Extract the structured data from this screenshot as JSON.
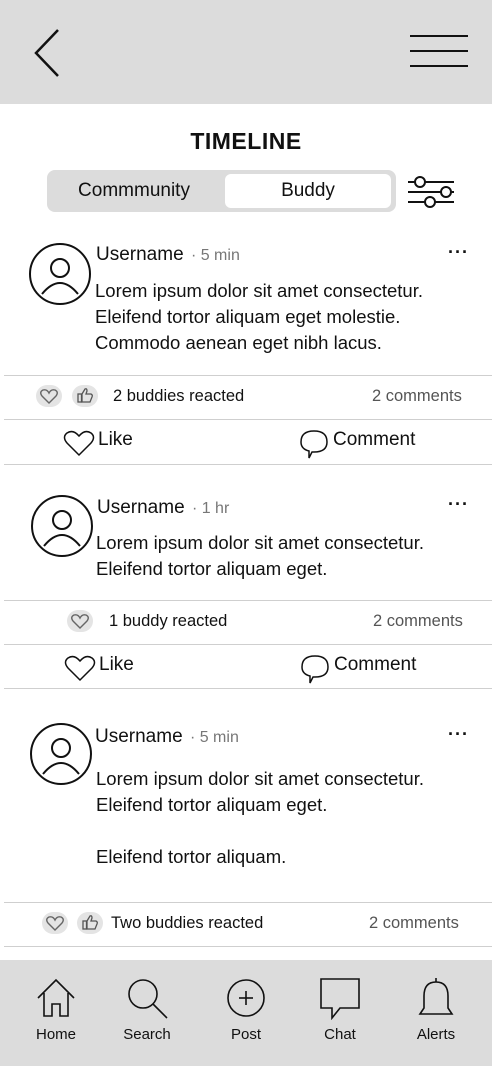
{
  "header": {
    "back_icon": "chevron-left-icon",
    "menu_icon": "hamburger-menu-icon"
  },
  "title": "TIMELINE",
  "tabs": {
    "community": "Commmunity",
    "buddy": "Buddy",
    "active": "Buddy"
  },
  "filter_icon": "sliders-icon",
  "posts": [
    {
      "username": "Username",
      "time": "· 5 min",
      "lines": [
        "Lorem ipsum dolor sit amet consectetur.",
        "Eleifend tortor aliquam eget molestie.",
        "Commodo aenean eget nibh lacus."
      ],
      "reactions": "2 buddies reacted",
      "comments": "2 comments",
      "like": "Like",
      "comment": "Comment"
    },
    {
      "username": "Username",
      "time": "· 1 hr",
      "lines": [
        "Lorem ipsum dolor sit amet consectetur.",
        "Eleifend tortor aliquam eget."
      ],
      "reactions": "1 buddy reacted",
      "comments": "2 comments",
      "like": "Like",
      "comment": "Comment"
    },
    {
      "username": "Username",
      "time": "· 5 min",
      "lines": [
        "Lorem ipsum dolor sit amet consectetur.",
        "Eleifend tortor aliquam eget.",
        "",
        "Eleifend tortor aliquam."
      ],
      "reactions": "Two buddies reacted",
      "comments": "2 comments"
    }
  ],
  "more_label": "···",
  "nav": {
    "home": "Home",
    "search": "Search",
    "post": "Post",
    "chat": "Chat",
    "alerts": "Alerts"
  }
}
